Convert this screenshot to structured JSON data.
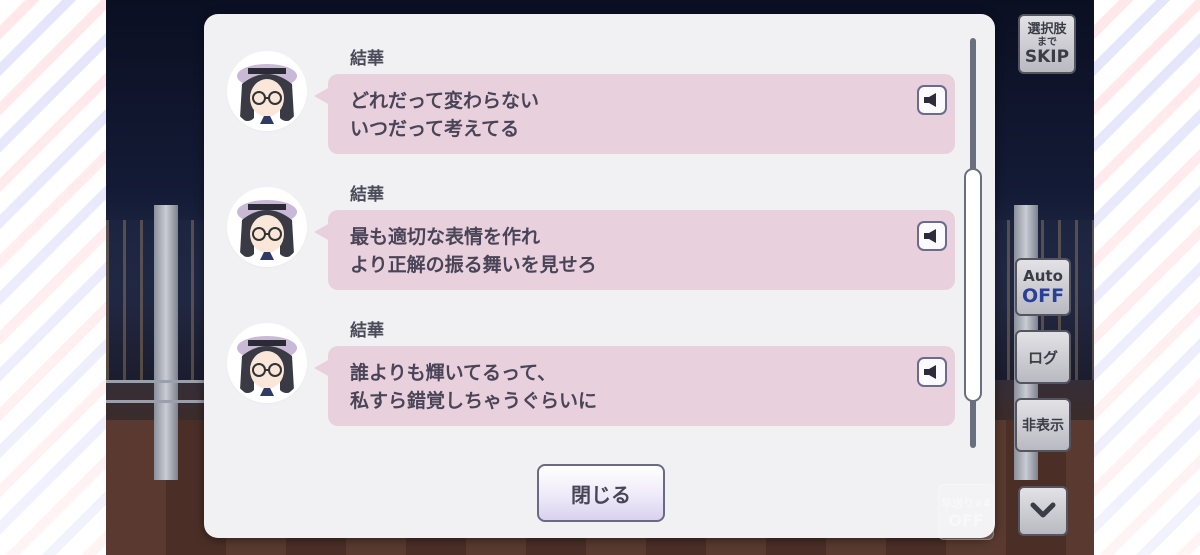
{
  "log": {
    "entries": [
      {
        "speaker": "結華",
        "line1": "どれだって変わらない",
        "line2": "いつだって考えてる"
      },
      {
        "speaker": "結華",
        "line1": "最も適切な表情を作れ",
        "line2": "より正解の振る舞いを見せろ"
      },
      {
        "speaker": "結華",
        "line1": "誰よりも輝いてるって、",
        "line2": "私すら錯覚しちゃうぐらいに"
      }
    ],
    "close_label": "閉じる"
  },
  "controls": {
    "skip": {
      "line1": "選択肢",
      "line2": "まで",
      "line3": "SKIP"
    },
    "auto": {
      "label": "Auto",
      "state": "OFF"
    },
    "log_label": "ログ",
    "hide_label": "非表示",
    "fast": {
      "label": "早送り×4",
      "state": "OFF"
    }
  },
  "icons": {
    "voice": "speaker-icon",
    "down": "chevron-down-icon"
  },
  "colors": {
    "bubble": "#e8d1dc",
    "dialog": "#f1f1f3",
    "text": "#4a4458"
  }
}
